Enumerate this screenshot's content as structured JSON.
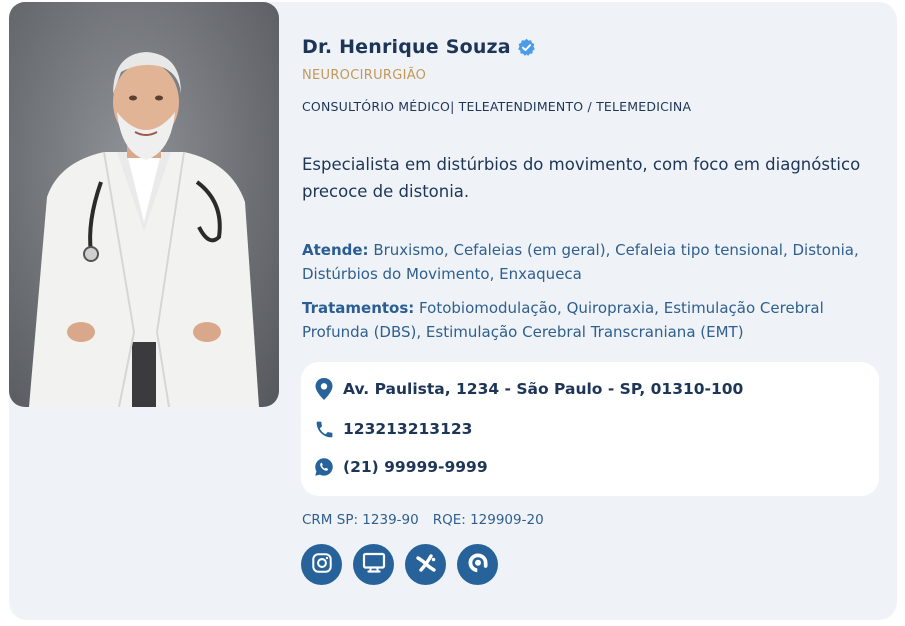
{
  "doctor": {
    "name": "Dr. Henrique Souza",
    "verified_icon": "verified-badge-icon",
    "specialty": "NEUROCIRURGIÃO",
    "services": "CONSULTÓRIO MÉDICO| TELEATENDIMENTO / TELEMEDICINA",
    "bio": "Especialista em distúrbios do movimento, com foco em diagnóstico precoce de distonia.",
    "atende_label": "Atende:",
    "atende_text": " Bruxismo, Cefaleias (em geral), Cefaleia tipo tensional, Distonia, Distúrbios do Movimento, Enxaqueca",
    "tratamentos_label": "Tratamentos:",
    "tratamentos_text": " Fotobiomodulação, Quiropraxia, Estimulação Cerebral Profunda (DBS), Estimulação Cerebral Transcraniana (EMT)"
  },
  "contact": {
    "address": "Av. Paulista, 1234 - São Paulo - SP, 01310-100",
    "phone": "123213213123",
    "whatsapp": "(21) 99999-9999"
  },
  "registration": {
    "crm": "CRM SP: 1239-90",
    "rqe": "RQE: 129909-20"
  },
  "socials": [
    "instagram-icon",
    "website-icon",
    "doctoralia-icon",
    "profile-logo-icon"
  ],
  "colors": {
    "card_bg": "#eff3f7",
    "primary": "#1d3557",
    "accent": "#c4975a",
    "link_blue": "#2f5f8f",
    "button_blue": "#27639a",
    "verified_blue": "#4a9be8"
  }
}
